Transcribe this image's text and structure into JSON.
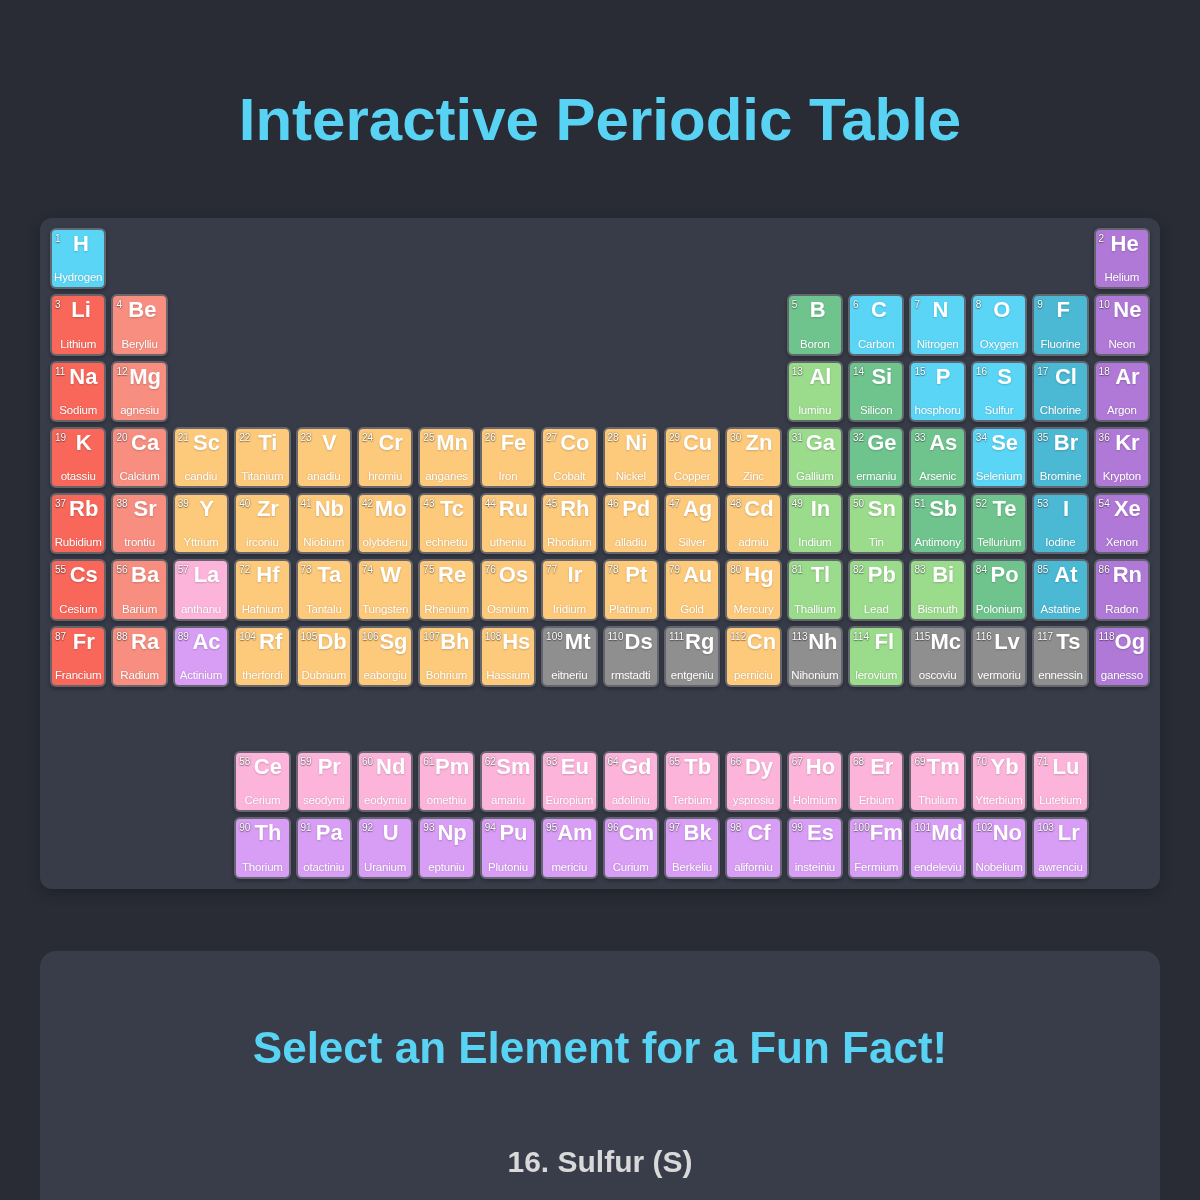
{
  "title": "Interactive Periodic Table",
  "periods": [
    {
      "left": [
        {
          "number": "1",
          "symbol": "H",
          "name": "Hydrogen",
          "color": "#5ad5f6"
        }
      ],
      "right": [
        {
          "number": "2",
          "symbol": "He",
          "name": "Helium",
          "color": "#b079d7"
        }
      ]
    },
    {
      "left": [
        {
          "number": "3",
          "symbol": "Li",
          "name": "Lithium",
          "color": "#f9675a"
        },
        {
          "number": "4",
          "symbol": "Be",
          "name": "Berylliu",
          "color": "#f78e80"
        }
      ],
      "right": [
        {
          "number": "5",
          "symbol": "B",
          "name": "Boron",
          "color": "#6fc48e"
        },
        {
          "number": "6",
          "symbol": "C",
          "name": "Carbon",
          "color": "#5ad5f6"
        },
        {
          "number": "7",
          "symbol": "N",
          "name": "Nitrogen",
          "color": "#5ad5f6"
        },
        {
          "number": "8",
          "symbol": "O",
          "name": "Oxygen",
          "color": "#5ad5f6"
        },
        {
          "number": "9",
          "symbol": "F",
          "name": "Fluorine",
          "color": "#4bb9d4"
        },
        {
          "number": "10",
          "symbol": "Ne",
          "name": "Neon",
          "color": "#b079d7"
        }
      ]
    },
    {
      "left": [
        {
          "number": "11",
          "symbol": "Na",
          "name": "Sodium",
          "color": "#f9675a"
        },
        {
          "number": "12",
          "symbol": "Mg",
          "name": "agnesiu",
          "color": "#f78e80"
        }
      ],
      "right": [
        {
          "number": "13",
          "symbol": "Al",
          "name": "luminu",
          "color": "#9bdb8c"
        },
        {
          "number": "14",
          "symbol": "Si",
          "name": "Silicon",
          "color": "#6fc48e"
        },
        {
          "number": "15",
          "symbol": "P",
          "name": "hosphoru",
          "color": "#5ad5f6"
        },
        {
          "number": "16",
          "symbol": "S",
          "name": "Sulfur",
          "color": "#5ad5f6"
        },
        {
          "number": "17",
          "symbol": "Cl",
          "name": "Chlorine",
          "color": "#4bb9d4"
        },
        {
          "number": "18",
          "symbol": "Ar",
          "name": "Argon",
          "color": "#b079d7"
        }
      ]
    },
    {
      "left": [
        {
          "number": "19",
          "symbol": "K",
          "name": "otassiu",
          "color": "#f9675a"
        },
        {
          "number": "20",
          "symbol": "Ca",
          "name": "Calcium",
          "color": "#f78e80"
        },
        {
          "number": "21",
          "symbol": "Sc",
          "name": "candiu",
          "color": "#fdc97a"
        },
        {
          "number": "22",
          "symbol": "Ti",
          "name": "Titanium",
          "color": "#fdc97a"
        },
        {
          "number": "23",
          "symbol": "V",
          "name": "anadiu",
          "color": "#fdc97a"
        },
        {
          "number": "24",
          "symbol": "Cr",
          "name": "hromiu",
          "color": "#fdc97a"
        },
        {
          "number": "25",
          "symbol": "Mn",
          "name": "anganes",
          "color": "#fdc97a"
        },
        {
          "number": "26",
          "symbol": "Fe",
          "name": "Iron",
          "color": "#fdc97a"
        },
        {
          "number": "27",
          "symbol": "Co",
          "name": "Cobalt",
          "color": "#fdc97a"
        },
        {
          "number": "28",
          "symbol": "Ni",
          "name": "Nickel",
          "color": "#fdc97a"
        },
        {
          "number": "29",
          "symbol": "Cu",
          "name": "Copper",
          "color": "#fdc97a"
        },
        {
          "number": "30",
          "symbol": "Zn",
          "name": "Zinc",
          "color": "#fdc97a"
        },
        {
          "number": "31",
          "symbol": "Ga",
          "name": "Gallium",
          "color": "#9bdb8c"
        },
        {
          "number": "32",
          "symbol": "Ge",
          "name": "ermaniu",
          "color": "#6fc48e"
        },
        {
          "number": "33",
          "symbol": "As",
          "name": "Arsenic",
          "color": "#6fc48e"
        },
        {
          "number": "34",
          "symbol": "Se",
          "name": "Selenium",
          "color": "#5ad5f6"
        },
        {
          "number": "35",
          "symbol": "Br",
          "name": "Bromine",
          "color": "#4bb9d4"
        },
        {
          "number": "36",
          "symbol": "Kr",
          "name": "Krypton",
          "color": "#b079d7"
        }
      ]
    },
    {
      "left": [
        {
          "number": "37",
          "symbol": "Rb",
          "name": "Rubidium",
          "color": "#f9675a"
        },
        {
          "number": "38",
          "symbol": "Sr",
          "name": "trontiu",
          "color": "#f78e80"
        },
        {
          "number": "39",
          "symbol": "Y",
          "name": "Yttrium",
          "color": "#fdc97a"
        },
        {
          "number": "40",
          "symbol": "Zr",
          "name": "irconiu",
          "color": "#fdc97a"
        },
        {
          "number": "41",
          "symbol": "Nb",
          "name": "Niobium",
          "color": "#fdc97a"
        },
        {
          "number": "42",
          "symbol": "Mo",
          "name": "olybdenu",
          "color": "#fdc97a"
        },
        {
          "number": "43",
          "symbol": "Tc",
          "name": "echnetiu",
          "color": "#fdc97a"
        },
        {
          "number": "44",
          "symbol": "Ru",
          "name": "utheniu",
          "color": "#fdc97a"
        },
        {
          "number": "45",
          "symbol": "Rh",
          "name": "Rhodium",
          "color": "#fdc97a"
        },
        {
          "number": "46",
          "symbol": "Pd",
          "name": "alladiu",
          "color": "#fdc97a"
        },
        {
          "number": "47",
          "symbol": "Ag",
          "name": "Silver",
          "color": "#fdc97a"
        },
        {
          "number": "48",
          "symbol": "Cd",
          "name": "admiu",
          "color": "#fdc97a"
        },
        {
          "number": "49",
          "symbol": "In",
          "name": "Indium",
          "color": "#9bdb8c"
        },
        {
          "number": "50",
          "symbol": "Sn",
          "name": "Tin",
          "color": "#9bdb8c"
        },
        {
          "number": "51",
          "symbol": "Sb",
          "name": "Antimony",
          "color": "#6fc48e"
        },
        {
          "number": "52",
          "symbol": "Te",
          "name": "Tellurium",
          "color": "#6fc48e"
        },
        {
          "number": "53",
          "symbol": "I",
          "name": "Iodine",
          "color": "#4bb9d4"
        },
        {
          "number": "54",
          "symbol": "Xe",
          "name": "Xenon",
          "color": "#b079d7"
        }
      ]
    },
    {
      "left": [
        {
          "number": "55",
          "symbol": "Cs",
          "name": "Cesium",
          "color": "#f9675a"
        },
        {
          "number": "56",
          "symbol": "Ba",
          "name": "Barium",
          "color": "#f78e80"
        },
        {
          "number": "57",
          "symbol": "La",
          "name": "anthanu",
          "color": "#fdb4db"
        },
        {
          "number": "72",
          "symbol": "Hf",
          "name": "Hafnium",
          "color": "#fdc97a"
        },
        {
          "number": "73",
          "symbol": "Ta",
          "name": "Tantalu",
          "color": "#fdc97a"
        },
        {
          "number": "74",
          "symbol": "W",
          "name": "Tungsten",
          "color": "#fdc97a"
        },
        {
          "number": "75",
          "symbol": "Re",
          "name": "Rhenium",
          "color": "#fdc97a"
        },
        {
          "number": "76",
          "symbol": "Os",
          "name": "Osmium",
          "color": "#fdc97a"
        },
        {
          "number": "77",
          "symbol": "Ir",
          "name": "Iridium",
          "color": "#fdc97a"
        },
        {
          "number": "78",
          "symbol": "Pt",
          "name": "Platinum",
          "color": "#fdc97a"
        },
        {
          "number": "79",
          "symbol": "Au",
          "name": "Gold",
          "color": "#fdc97a"
        },
        {
          "number": "80",
          "symbol": "Hg",
          "name": "Mercury",
          "color": "#fdc97a"
        },
        {
          "number": "81",
          "symbol": "Tl",
          "name": "Thallium",
          "color": "#9bdb8c"
        },
        {
          "number": "82",
          "symbol": "Pb",
          "name": "Lead",
          "color": "#9bdb8c"
        },
        {
          "number": "83",
          "symbol": "Bi",
          "name": "Bismuth",
          "color": "#9bdb8c"
        },
        {
          "number": "84",
          "symbol": "Po",
          "name": "Polonium",
          "color": "#6fc48e"
        },
        {
          "number": "85",
          "symbol": "At",
          "name": "Astatine",
          "color": "#4bb9d4"
        },
        {
          "number": "86",
          "symbol": "Rn",
          "name": "Radon",
          "color": "#b079d7"
        }
      ]
    },
    {
      "left": [
        {
          "number": "87",
          "symbol": "Fr",
          "name": "Francium",
          "color": "#f9675a"
        },
        {
          "number": "88",
          "symbol": "Ra",
          "name": "Radium",
          "color": "#f78e80"
        },
        {
          "number": "89",
          "symbol": "Ac",
          "name": "Actinium",
          "color": "#d89df5"
        },
        {
          "number": "104",
          "symbol": "Rf",
          "name": "therfordi",
          "color": "#fdc97a"
        },
        {
          "number": "105",
          "symbol": "Db",
          "name": "Dubnium",
          "color": "#fdc97a"
        },
        {
          "number": "106",
          "symbol": "Sg",
          "name": "eaborgiu",
          "color": "#fdc97a"
        },
        {
          "number": "107",
          "symbol": "Bh",
          "name": "Bohrium",
          "color": "#fdc97a"
        },
        {
          "number": "108",
          "symbol": "Hs",
          "name": "Hassium",
          "color": "#fdc97a"
        },
        {
          "number": "109",
          "symbol": "Mt",
          "name": "eitneriu",
          "color": "#8f8f8f"
        },
        {
          "number": "110",
          "symbol": "Ds",
          "name": "rmstadti",
          "color": "#8f8f8f"
        },
        {
          "number": "111",
          "symbol": "Rg",
          "name": "entgeniu",
          "color": "#8f8f8f"
        },
        {
          "number": "112",
          "symbol": "Cn",
          "name": "perniciu",
          "color": "#fdc97a"
        },
        {
          "number": "113",
          "symbol": "Nh",
          "name": "Nihonium",
          "color": "#8f8f8f"
        },
        {
          "number": "114",
          "symbol": "Fl",
          "name": "lerovium",
          "color": "#9bdb8c"
        },
        {
          "number": "115",
          "symbol": "Mc",
          "name": "oscoviu",
          "color": "#8f8f8f"
        },
        {
          "number": "116",
          "symbol": "Lv",
          "name": "vermoriu",
          "color": "#8f8f8f"
        },
        {
          "number": "117",
          "symbol": "Ts",
          "name": "ennessin",
          "color": "#8f8f8f"
        },
        {
          "number": "118",
          "symbol": "Og",
          "name": "ganesso",
          "color": "#b079d7"
        }
      ]
    }
  ],
  "f_block": [
    {
      "elements": [
        {
          "number": "58",
          "symbol": "Ce",
          "name": "Cerium",
          "color": "#fdb4db"
        },
        {
          "number": "59",
          "symbol": "Pr",
          "name": "seodymi",
          "color": "#fdb4db"
        },
        {
          "number": "60",
          "symbol": "Nd",
          "name": "eodymiu",
          "color": "#fdb4db"
        },
        {
          "number": "61",
          "symbol": "Pm",
          "name": "omethiu",
          "color": "#fdb4db"
        },
        {
          "number": "62",
          "symbol": "Sm",
          "name": "amariu",
          "color": "#fdb4db"
        },
        {
          "number": "63",
          "symbol": "Eu",
          "name": "Europium",
          "color": "#fdb4db"
        },
        {
          "number": "64",
          "symbol": "Gd",
          "name": "adoliniu",
          "color": "#fdb4db"
        },
        {
          "number": "65",
          "symbol": "Tb",
          "name": "Terbium",
          "color": "#fdb4db"
        },
        {
          "number": "66",
          "symbol": "Dy",
          "name": "ysprosiu",
          "color": "#fdb4db"
        },
        {
          "number": "67",
          "symbol": "Ho",
          "name": "Holmium",
          "color": "#fdb4db"
        },
        {
          "number": "68",
          "symbol": "Er",
          "name": "Erbium",
          "color": "#fdb4db"
        },
        {
          "number": "69",
          "symbol": "Tm",
          "name": "Thulium",
          "color": "#fdb4db"
        },
        {
          "number": "70",
          "symbol": "Yb",
          "name": "Ytterbium",
          "color": "#fdb4db"
        },
        {
          "number": "71",
          "symbol": "Lu",
          "name": "Lutetium",
          "color": "#fdb4db"
        }
      ]
    },
    {
      "elements": [
        {
          "number": "90",
          "symbol": "Th",
          "name": "Thorium",
          "color": "#d89df5"
        },
        {
          "number": "91",
          "symbol": "Pa",
          "name": "otactiniu",
          "color": "#d89df5"
        },
        {
          "number": "92",
          "symbol": "U",
          "name": "Uranium",
          "color": "#d89df5"
        },
        {
          "number": "93",
          "symbol": "Np",
          "name": "eptuniu",
          "color": "#d89df5"
        },
        {
          "number": "94",
          "symbol": "Pu",
          "name": "Plutoniu",
          "color": "#d89df5"
        },
        {
          "number": "95",
          "symbol": "Am",
          "name": "mericiu",
          "color": "#d89df5"
        },
        {
          "number": "96",
          "symbol": "Cm",
          "name": "Curium",
          "color": "#d89df5"
        },
        {
          "number": "97",
          "symbol": "Bk",
          "name": "Berkeliu",
          "color": "#d89df5"
        },
        {
          "number": "98",
          "symbol": "Cf",
          "name": "aliforniu",
          "color": "#d89df5"
        },
        {
          "number": "99",
          "symbol": "Es",
          "name": "insteiniu",
          "color": "#d89df5"
        },
        {
          "number": "100",
          "symbol": "Fm",
          "name": "Fermium",
          "color": "#d89df5"
        },
        {
          "number": "101",
          "symbol": "Md",
          "name": "endeleviu",
          "color": "#d89df5"
        },
        {
          "number": "102",
          "symbol": "No",
          "name": "Nobelium",
          "color": "#d89df5"
        },
        {
          "number": "103",
          "symbol": "Lr",
          "name": "awrenciu",
          "color": "#d89df5"
        }
      ]
    }
  ],
  "fun_fact": {
    "heading": "Select an Element for a Fun Fact!",
    "element": "16. Sulfur (S)"
  }
}
